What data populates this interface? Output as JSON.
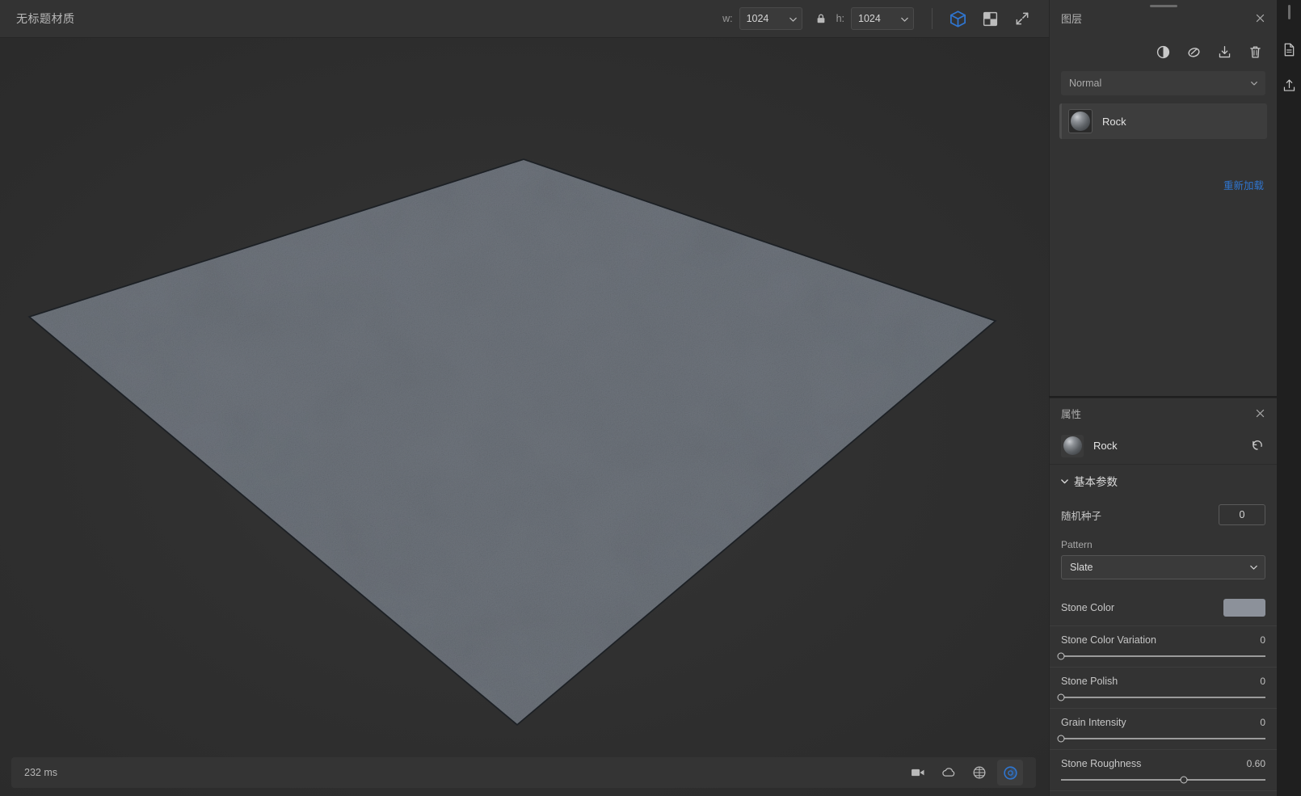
{
  "app": {
    "document_title": "无标题材质",
    "accent_color": "#2f76d1",
    "panel_bg": "#333333",
    "viewport_bg": "#2e2e2e"
  },
  "toolbar": {
    "width_label": "w:",
    "width_value": "1024",
    "height_label": "h:",
    "height_value": "1024",
    "lock_icon": "lock-icon",
    "buttons": [
      {
        "name": "3d-view-button",
        "icon": "cube-icon",
        "active": true
      },
      {
        "name": "2d-tile-button",
        "icon": "checkerboard-icon",
        "active": false
      },
      {
        "name": "fullscreen-button",
        "icon": "expand-arrows-icon",
        "active": false
      }
    ]
  },
  "viewport": {
    "status_text": "232 ms",
    "status_icons": [
      {
        "name": "camera-button",
        "icon": "video-camera-icon",
        "active": false
      },
      {
        "name": "environment-button",
        "icon": "cloud-icon",
        "active": false
      },
      {
        "name": "grid-button",
        "icon": "globe-grid-icon",
        "active": false
      },
      {
        "name": "render-mode-button",
        "icon": "circle-accent-icon",
        "active": true
      }
    ]
  },
  "layers_panel": {
    "title": "图层",
    "close_icon": "close-icon",
    "tools": [
      {
        "name": "adjustment-layer-button",
        "icon": "half-circle-contrast-icon"
      },
      {
        "name": "filter-layer-button",
        "icon": "smudge-blur-icon"
      },
      {
        "name": "import-layer-button",
        "icon": "import-download-icon"
      },
      {
        "name": "delete-layer-button",
        "icon": "trash-icon"
      }
    ],
    "blend_mode": "Normal",
    "layers": [
      {
        "name": "Rock",
        "thumbnail": "sphere-preview"
      }
    ],
    "reload_link": "重新加载"
  },
  "properties_panel": {
    "title": "属性",
    "close_icon": "close-icon",
    "selected_layer": "Rock",
    "reset_icon": "reset-arrow-icon",
    "section_title": "基本参数",
    "section_expanded": true,
    "seed": {
      "label": "随机种子",
      "value": "0"
    },
    "pattern": {
      "label": "Pattern",
      "value": "Slate"
    },
    "stone_color": {
      "label": "Stone Color",
      "swatch": "#8c919a"
    },
    "sliders": [
      {
        "label": "Stone Color Variation",
        "value": "0",
        "fraction": 0.0
      },
      {
        "label": "Stone Polish",
        "value": "0",
        "fraction": 0.0
      },
      {
        "label": "Grain Intensity",
        "value": "0",
        "fraction": 0.0
      },
      {
        "label": "Stone Roughness",
        "value": "0.60",
        "fraction": 0.6
      }
    ]
  },
  "rail": {
    "buttons": [
      {
        "name": "export-document-button",
        "icon": "document-export-icon"
      },
      {
        "name": "share-upload-button",
        "icon": "upload-share-icon"
      }
    ]
  }
}
